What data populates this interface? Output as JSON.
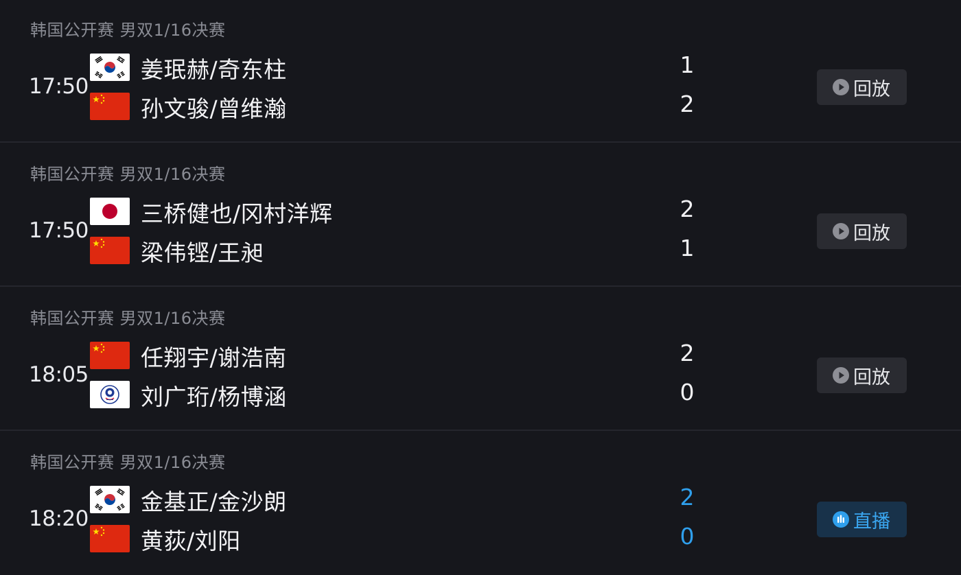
{
  "matches": [
    {
      "event": "韩国公开赛 男双1/16决赛",
      "time": "17:50",
      "team1": {
        "flag": "korea-flag",
        "names": "姜珉赫/奇东柱",
        "score": "1"
      },
      "team2": {
        "flag": "china-flag",
        "names": "孙文骏/曾维瀚",
        "score": "2"
      },
      "status": "replay",
      "button": {
        "label": "回放",
        "icon": "play-icon"
      }
    },
    {
      "event": "韩国公开赛 男双1/16决赛",
      "time": "17:50",
      "team1": {
        "flag": "japan-flag",
        "names": "三桥健也/冈村洋辉",
        "score": "2"
      },
      "team2": {
        "flag": "china-flag",
        "names": "梁伟铿/王昶",
        "score": "1"
      },
      "status": "replay",
      "button": {
        "label": "回放",
        "icon": "play-icon"
      }
    },
    {
      "event": "韩国公开赛 男双1/16决赛",
      "time": "18:05",
      "team1": {
        "flag": "china-flag",
        "names": "任翔宇/谢浩南",
        "score": "2"
      },
      "team2": {
        "flag": "chinese-taipei-flag",
        "names": "刘广珩/杨博涵",
        "score": "0"
      },
      "status": "replay",
      "button": {
        "label": "回放",
        "icon": "play-icon"
      }
    },
    {
      "event": "韩国公开赛 男双1/16决赛",
      "time": "18:20",
      "team1": {
        "flag": "korea-flag",
        "names": "金基正/金沙朗",
        "score": "2"
      },
      "team2": {
        "flag": "china-flag",
        "names": "黄荻/刘阳",
        "score": "0"
      },
      "status": "live",
      "button": {
        "label": "直播",
        "icon": "live-bars-icon"
      }
    }
  ],
  "colors": {
    "background": "#16171c",
    "divider": "#25262d",
    "live_accent": "#2f9fec",
    "replay_button_bg": "#2a2b31",
    "live_button_bg": "#18324a",
    "muted_text": "#8a8c94"
  }
}
